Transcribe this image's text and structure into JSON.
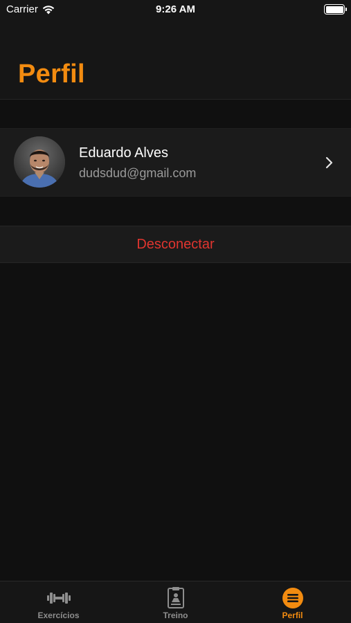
{
  "status_bar": {
    "carrier": "Carrier",
    "time": "9:26 AM"
  },
  "header": {
    "title": "Perfil"
  },
  "profile": {
    "name": "Eduardo Alves",
    "email": "dudsdud@gmail.com"
  },
  "actions": {
    "disconnect_label": "Desconectar"
  },
  "tabs": [
    {
      "label": "Exercícios",
      "icon": "dumbbell-icon",
      "active": false
    },
    {
      "label": "Treino",
      "icon": "workout-board-icon",
      "active": false
    },
    {
      "label": "Perfil",
      "icon": "menu-lines-icon",
      "active": true
    }
  ],
  "colors": {
    "accent": "#f28b10",
    "destructive": "#e0352f",
    "background": "#101010"
  }
}
